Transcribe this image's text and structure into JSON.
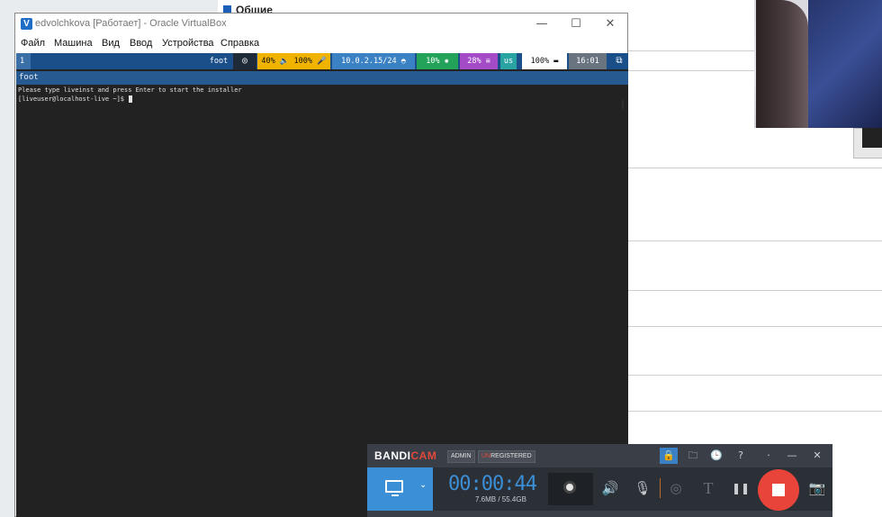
{
  "background": {
    "header": "Общие"
  },
  "vbox": {
    "title": "edvolchkova [Работает] - Oracle VirtualBox",
    "controls": {
      "minimize": "—",
      "maximize": "☐",
      "close": "✕"
    },
    "menu": [
      "Файл",
      "Машина",
      "Вид",
      "Ввод",
      "Устройства",
      "Справка"
    ]
  },
  "statusbar": {
    "workspace": "1",
    "app": "foot",
    "volume": "40% 🔈 100% 🎤",
    "network": "10.0.2.15/24",
    "cpu": "10%",
    "memory": "28% ≡",
    "layout": "us",
    "battery": "100%",
    "clock": "16:01",
    "colors": {
      "bar": "#1a4f8a",
      "volume": "#f0b400",
      "network": "#3b82c4",
      "cpu": "#23a35a",
      "memory": "#a44bc8",
      "layout": "#2aa3a3",
      "battery": "#ffffff",
      "clock": "#6a7480"
    }
  },
  "terminal": {
    "title": "foot",
    "lines": [
      "Please type liveinst and press Enter to start the installer",
      "[liveuser@localhost-live ~]$ "
    ]
  },
  "bandicam": {
    "logo_a": "BANDI",
    "logo_b": "CAM",
    "badge_admin": "ADMIN",
    "badge_unreg_un": "UN",
    "badge_unreg_rest": "REGISTERED",
    "timer": "00:00:44",
    "size": "7.6MB / 55.4GB",
    "top_icons": {
      "lock": "🔒",
      "folder": "🗀",
      "clock": "🕒",
      "help": "?",
      "dot": "·",
      "minimize": "—",
      "close": "✕"
    },
    "icons": {
      "speaker": "🔊",
      "mic": "🎙",
      "cursor": "◎",
      "text": "T",
      "pause": "❚❚",
      "camera": "📷"
    },
    "accent": "#3b8fd6",
    "record_color": "#e8443a"
  }
}
